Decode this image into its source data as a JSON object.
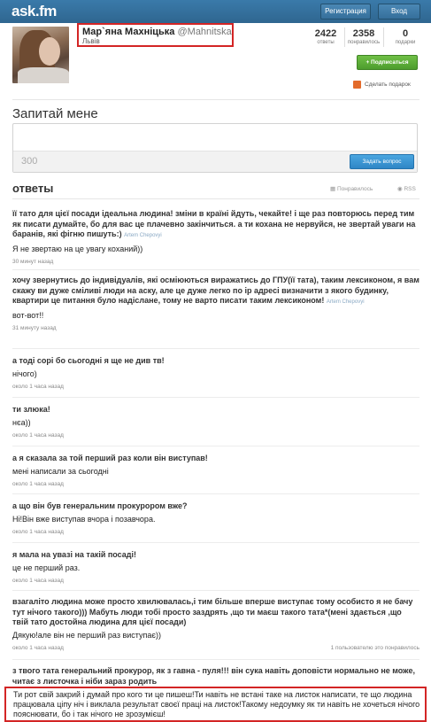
{
  "header": {
    "logo": "ask.fm",
    "register_label": "Регистрация",
    "login_label": "Вход"
  },
  "profile": {
    "name": "Мар`яна Махніцька",
    "username": "@Mahnitska",
    "city": "Львів",
    "stats": [
      {
        "value": "2422",
        "label": "ответы"
      },
      {
        "value": "2358",
        "label": "понравилось"
      },
      {
        "value": "0",
        "label": "подарки"
      }
    ],
    "subscribe_label": "+ Подписаться",
    "gift_label": "Сделать подарок"
  },
  "ask": {
    "title": "Запитай мене",
    "counter": "300",
    "submit_label": "Задать вопрос"
  },
  "answers": {
    "title": "ответы",
    "liked_label": "Понравилось",
    "rss_label": "RSS",
    "items": [
      {
        "question": "її тато для цієї посади ідеальна людина! зміни в країні йдуть, чекайте! і ще раз повторюсь перед тим як писати думайте, бо для вас це плачевно закінчиться. а ти кохана не нервуйся, не звертай уваги на баранів, які фігню пишуть:)",
        "asker": "Artem Chepovyi",
        "answer": "Я не звертаю на це увагу коханий))",
        "time": "30 минут назад"
      },
      {
        "question": "хочу звернутись до індивідуалів, які осміюються виражатись до ГПУ(її тата), таким лексиконом, я вам скажу ви дуже сміливі люди на аску, але це дуже легко по ір адресі визначити з якого будинку, квартири це питання було надіслане, тому не варто писати таким лексиконом!",
        "asker": "Artem Chepovyi",
        "answer": "вот-вот!!",
        "time": "31 минуту назад"
      },
      {
        "question": "а тоді сорі бо сьогодні я ще не див тв!",
        "answer": "нічого)",
        "time": "около 1 часа назад"
      },
      {
        "question": "ти злюка!",
        "answer": "нєа))",
        "time": "около 1 часа назад"
      },
      {
        "question": "а я сказала за той перший раз коли він виступав!",
        "answer": "мені написали за сьогодні",
        "time": "около 1 часа назад"
      },
      {
        "question": "а що він був генеральним прокурором вже?",
        "answer": "Ні!Він вже виступав вчора і позавчора.",
        "time": "около 1 часа назад"
      },
      {
        "question": "я мала на увазі на такій посаді!",
        "answer": "це не перший раз.",
        "time": "около 1 часа назад"
      },
      {
        "question": "взагаліто людина може просто хвилювалась,і тим більше вперше виступає тому особисто я не бачу тут нічого такого))) Мабуть люди тобі просто заздрять ,що ти маєш такого тата*(мені здається ,що твій тато достойна людина для цієї посади)",
        "answer": "Дякую!але він не перший раз виступає))",
        "time": "около 1 часа назад",
        "likes": "1 пользователю это понравилось"
      },
      {
        "question": "з твого тата генеральний прокурор, як з гавна - пуля!!! він сука навіть доповісти нормально не може, читає з листочка і ніби зараз родить",
        "answer": "Ти рот свій закрий і думай про кого ти це пишеш!Ти навіть не встані таке на листок написати, те що людина працювала ціпу ніч і виклала результат своєї праці на листок!Такому недоумку як ти навіть не хочеться нічого пояснювати, бо і так нічого не зрозумієш!"
      }
    ]
  }
}
